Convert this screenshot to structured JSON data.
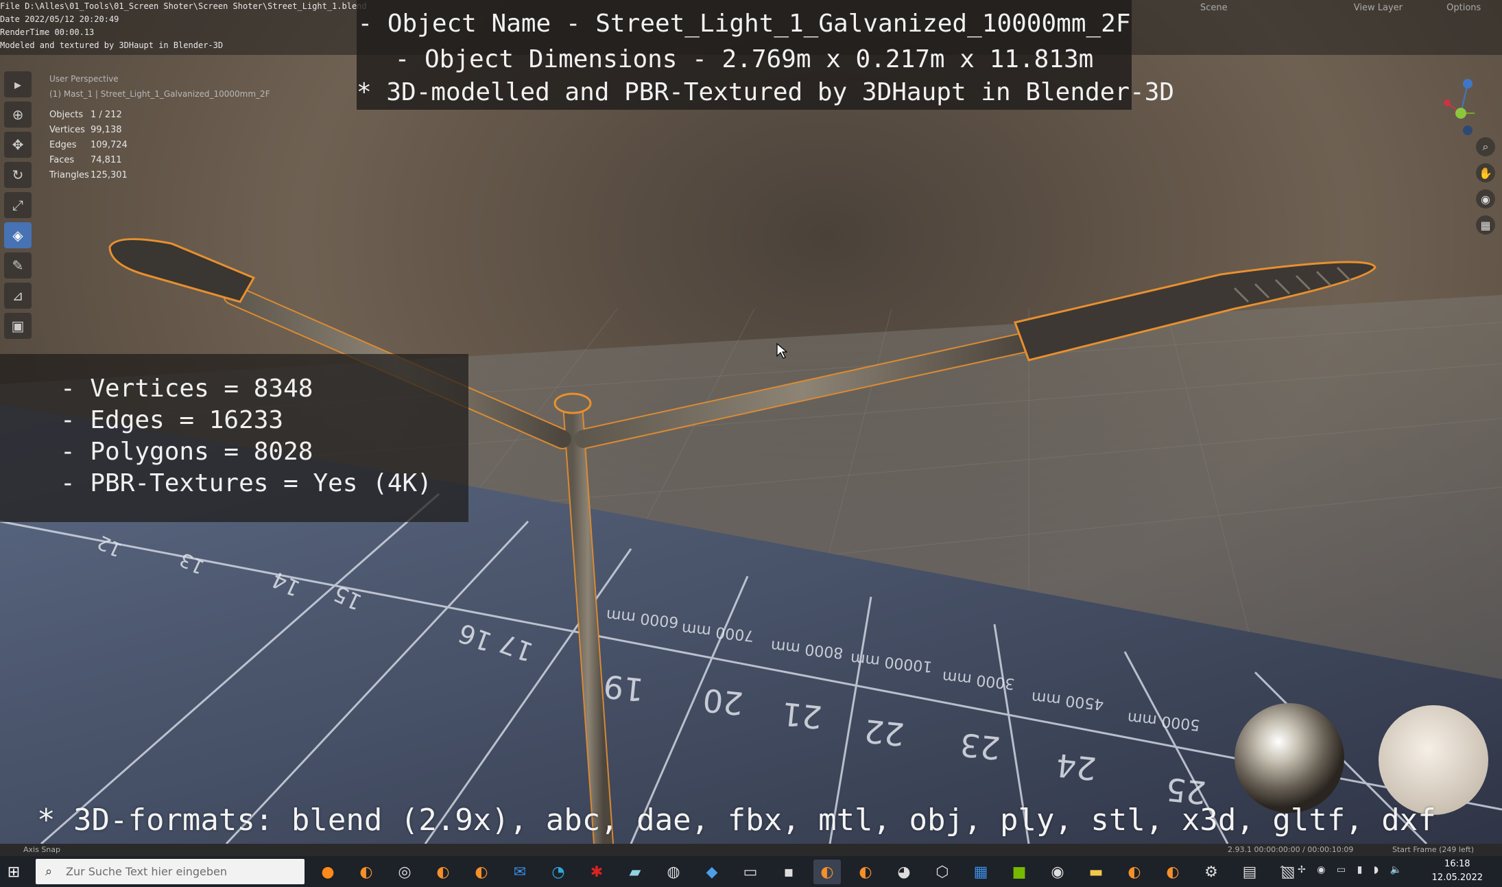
{
  "file_info": {
    "file": "File D:\\Alles\\01_Tools\\01_Screen Shoter\\Screen Shoter\\Street_Light_1.blend",
    "date": "Date 2022/05/12 20:20:49",
    "render_time": "RenderTime 00:00.13",
    "credit": "Modeled and textured by 3DHaupt in Blender-3D"
  },
  "banner": {
    "line1": "- Object Name - Street_Light_1_Galvanized_10000mm_2F",
    "line2": "- Object Dimensions -  2.769m x 0.217m x 11.813m",
    "line3": "* 3D-modelled and PBR-Textured by 3DHaupt in Blender-3D"
  },
  "viewport": {
    "perspective": "User Perspective",
    "object_path": "(1) Mast_1 | Street_Light_1_Galvanized_10000mm_2F"
  },
  "scene_stats": [
    {
      "label": "Objects",
      "value": "1 / 212"
    },
    {
      "label": "Vertices",
      "value": "99,138"
    },
    {
      "label": "Edges",
      "value": "109,724"
    },
    {
      "label": "Faces",
      "value": "74,811"
    },
    {
      "label": "Triangles",
      "value": "125,301"
    }
  ],
  "header_right": {
    "scene": "Scene",
    "view_layer": "View Layer",
    "options": "Options"
  },
  "mesh_stats": {
    "vertices": "- Vertices = 8348",
    "edges": "- Edges = 16233",
    "polygons": "- Polygons = 8028",
    "textures": "- PBR-Textures =  Yes (4K)"
  },
  "formats": "* 3D-formats: blend (2.9x), abc, dae, fbx, mtl, obj, ply, stl, x3d, gltf, dxf",
  "status_bar": {
    "left": "Axis Snap",
    "version": "2.93.1  00:00:00:00 / 00:00:10:09",
    "frame": "Start Frame (249 left)"
  },
  "taskbar": {
    "search_placeholder": "Zur Suche Text hier eingeben",
    "time": "16:18",
    "date": "12.05.2022"
  },
  "toolbar_icons": [
    "select-box-icon",
    "cursor-icon",
    "move-icon",
    "rotate-icon",
    "scale-icon",
    "transform-icon",
    "annotate-icon",
    "measure-icon",
    "add-cube-icon"
  ],
  "nav_icons": [
    "zoom-icon",
    "pan-hand-icon",
    "camera-icon",
    "grid-icon"
  ],
  "taskbar_icons": [
    "firefox-icon",
    "blender-icon",
    "obs-icon",
    "blender-icon",
    "blender-icon",
    "mail-icon",
    "edge-icon",
    "app-icon",
    "notes-icon",
    "app-icon",
    "app-icon",
    "terminal-icon",
    "app-icon",
    "blender-icon",
    "blender-icon",
    "panda-icon",
    "cube-icon",
    "calendar-icon",
    "nvidia-icon",
    "app-icon",
    "folder-icon",
    "blender-icon",
    "blender-icon",
    "settings-icon",
    "app-icon",
    "app-icon"
  ],
  "colors": {
    "selection_outline": "#e8902f",
    "active_tool": "#4772b3",
    "grid_mat": "#3e4a63"
  }
}
